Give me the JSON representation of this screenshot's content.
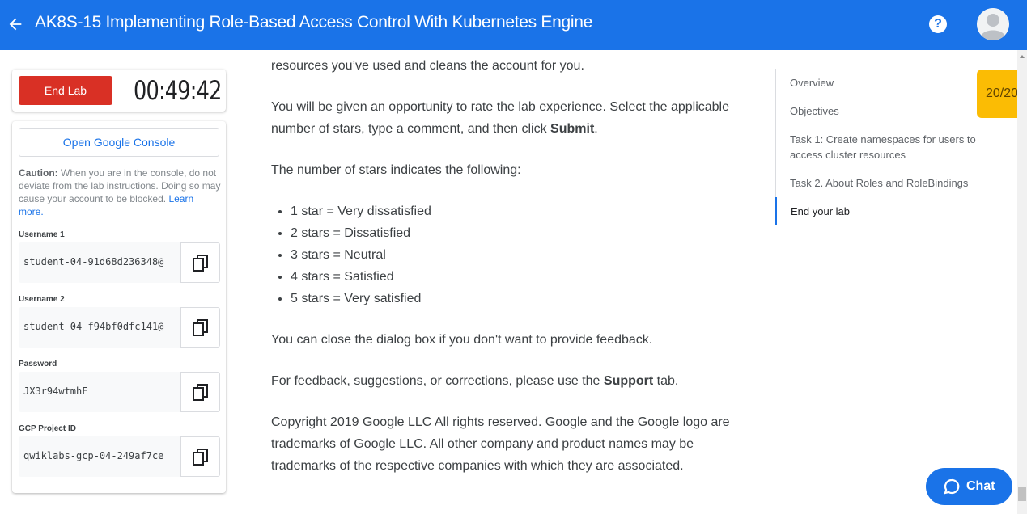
{
  "header": {
    "title": "AK8S-15 Implementing Role-Based Access Control With Kubernetes Engine",
    "help_icon": "?"
  },
  "timer_panel": {
    "end_label": "End Lab",
    "time": "00:49:42"
  },
  "credentials": {
    "console_label": "Open Google Console",
    "caution_bold": "Caution:",
    "caution_text": " When you are in the console, do not deviate from the lab instructions. Doing so may cause your account to be blocked. ",
    "learn_more": "Learn more.",
    "fields": [
      {
        "label": "Username 1",
        "value": "student-04-91d68d236348@"
      },
      {
        "label": "Username 2",
        "value": "student-04-f94bf0dfc141@"
      },
      {
        "label": "Password",
        "value": "JX3r94wtmhF"
      },
      {
        "label": "GCP Project ID",
        "value": "qwiklabs-gcp-04-249af7ce"
      }
    ]
  },
  "content": {
    "p0": "resources you’ve used and cleans the account for you.",
    "p1_a": "You will be given an opportunity to rate the lab experience. Select the applicable number of stars, type a comment, and then click ",
    "p1_b": "Submit",
    "p1_c": ".",
    "p2": "The number of stars indicates the following:",
    "stars": [
      "1 star = Very dissatisfied",
      "2 stars = Dissatisfied",
      "3 stars = Neutral",
      "4 stars = Satisfied",
      "5 stars = Very satisfied"
    ],
    "p3": "You can close the dialog box if you don't want to provide feedback.",
    "p4_a": "For feedback, suggestions, or corrections, please use the ",
    "p4_b": "Support",
    "p4_c": " tab.",
    "p5": "Copyright 2019 Google LLC All rights reserved. Google and the Google logo are trademarks of Google LLC. All other company and product names may be trademarks of the respective companies with which they are associated."
  },
  "toc": {
    "items": [
      "Overview",
      "Objectives",
      "Task 1: Create namespaces for users to access cluster resources",
      "Task 2. About Roles and RoleBindings",
      "End your lab"
    ]
  },
  "score": "20/20",
  "chat_label": "Chat",
  "colors": {
    "brand": "#1a73e8",
    "end": "#d93025",
    "score": "#fbbc04"
  }
}
